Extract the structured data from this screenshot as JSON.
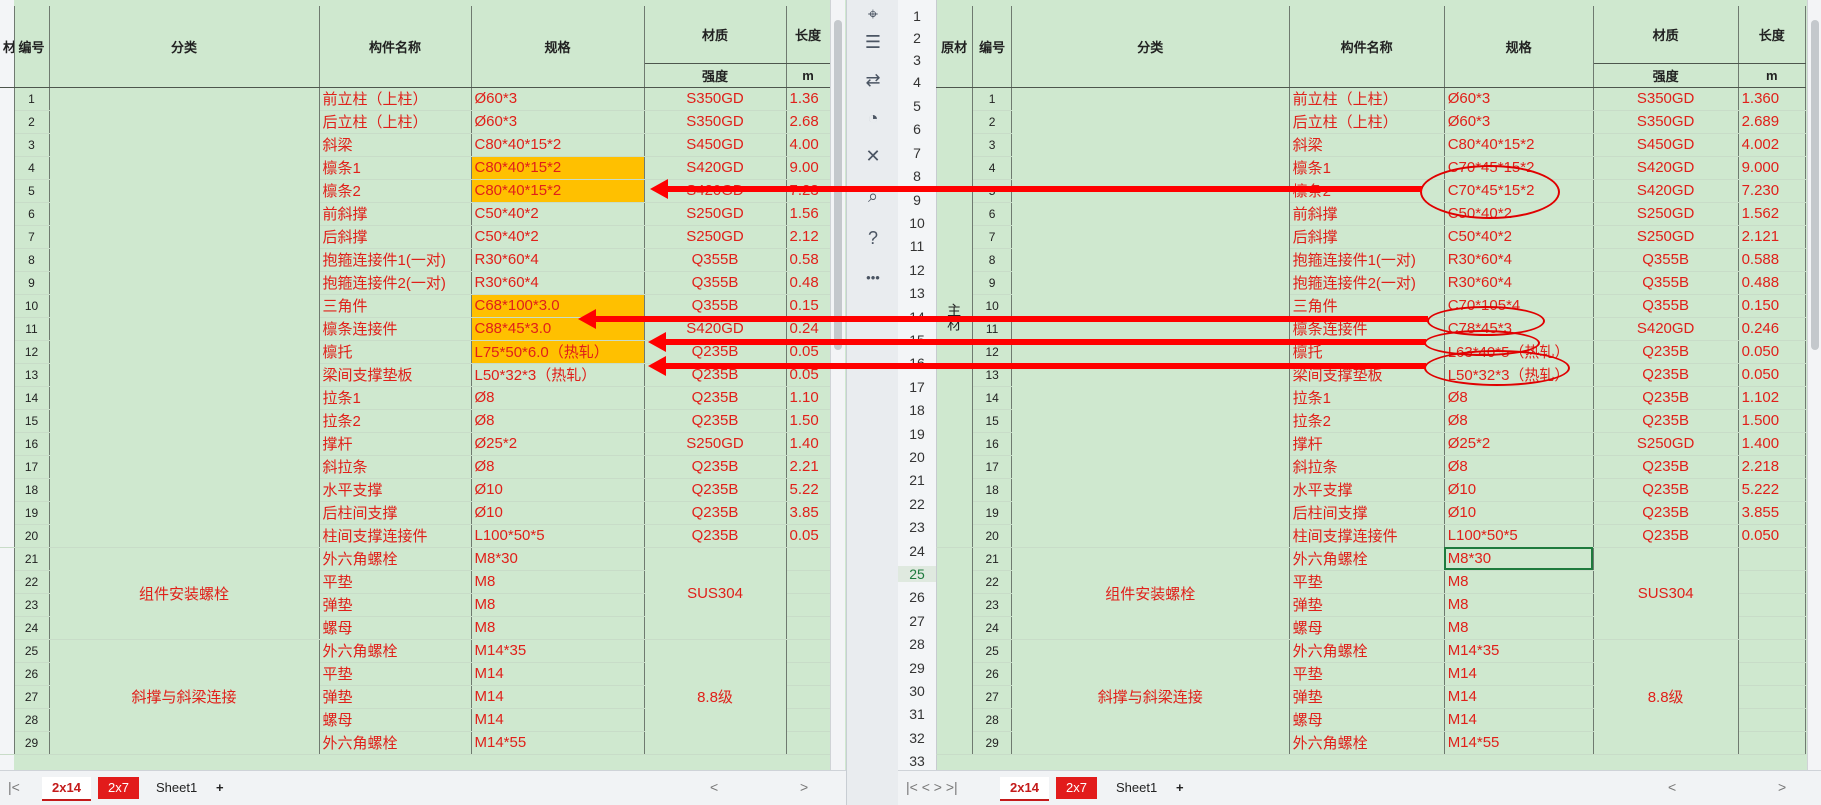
{
  "headers": {
    "yuancai": "原材",
    "biaohao": "编号",
    "fenlei": "分类",
    "goujian": "构件名称",
    "guige": "规格",
    "caizhi": "材质",
    "qiangdu": "强度",
    "changdu": "长度",
    "unit_m": "m",
    "left_clip": "材"
  },
  "zhucai_label": "主材",
  "left_rows": [
    {
      "no": "1",
      "name": "前立柱（上柱）",
      "spec": "Ø60*3",
      "mat": "S350GD",
      "len": "1.36"
    },
    {
      "no": "2",
      "name": "后立柱（上柱）",
      "spec": "Ø60*3",
      "mat": "S350GD",
      "len": "2.68"
    },
    {
      "no": "3",
      "name": "斜梁",
      "spec": "C80*40*15*2",
      "mat": "S450GD",
      "len": "4.00"
    },
    {
      "no": "4",
      "name": "檩条1",
      "spec": "C80*40*15*2",
      "mat": "S420GD",
      "len": "9.00",
      "hl": true
    },
    {
      "no": "5",
      "name": "檩条2",
      "spec": "C80*40*15*2",
      "mat": "S420GD",
      "len": "7.23",
      "hl": true
    },
    {
      "no": "6",
      "name": "前斜撑",
      "spec": "C50*40*2",
      "mat": "S250GD",
      "len": "1.56"
    },
    {
      "no": "7",
      "name": "后斜撑",
      "spec": "C50*40*2",
      "mat": "S250GD",
      "len": "2.12"
    },
    {
      "no": "8",
      "name": "抱箍连接件1(一对)",
      "spec": "R30*60*4",
      "mat": "Q355B",
      "len": "0.58"
    },
    {
      "no": "9",
      "name": "抱箍连接件2(一对)",
      "spec": "R30*60*4",
      "mat": "Q355B",
      "len": "0.48"
    },
    {
      "no": "10",
      "name": "三角件",
      "spec": "C68*100*3.0",
      "mat": "Q355B",
      "len": "0.15",
      "hl": true
    },
    {
      "no": "11",
      "name": "檩条连接件",
      "spec": "C88*45*3.0",
      "mat": "S420GD",
      "len": "0.24",
      "hl": true
    },
    {
      "no": "12",
      "name": "檩托",
      "spec": "L75*50*6.0（热轧）",
      "mat": "Q235B",
      "len": "0.05",
      "hl": true
    },
    {
      "no": "13",
      "name": "梁间支撑垫板",
      "spec": "L50*32*3（热轧）",
      "mat": "Q235B",
      "len": "0.05"
    },
    {
      "no": "14",
      "name": "拉条1",
      "spec": "Ø8",
      "mat": "Q235B",
      "len": "1.10"
    },
    {
      "no": "15",
      "name": "拉条2",
      "spec": "Ø8",
      "mat": "Q235B",
      "len": "1.50"
    },
    {
      "no": "16",
      "name": "撑杆",
      "spec": "Ø25*2",
      "mat": "S250GD",
      "len": "1.40"
    },
    {
      "no": "17",
      "name": "斜拉条",
      "spec": "Ø8",
      "mat": "Q235B",
      "len": "2.21"
    },
    {
      "no": "18",
      "name": "水平支撑",
      "spec": "Ø10",
      "mat": "Q235B",
      "len": "5.22"
    },
    {
      "no": "19",
      "name": "后柱间支撑",
      "spec": "Ø10",
      "mat": "Q235B",
      "len": "3.85"
    },
    {
      "no": "20",
      "name": "柱间支撑连接件",
      "spec": "L100*50*5",
      "mat": "Q235B",
      "len": "0.05"
    },
    {
      "no": "21",
      "name": "外六角螺栓",
      "spec": "M8*30",
      "mat": "",
      "len": ""
    },
    {
      "no": "22",
      "name": "平垫",
      "spec": "M8",
      "mat": "SUS304",
      "len": ""
    },
    {
      "no": "23",
      "name": "弹垫",
      "spec": "M8",
      "mat": "",
      "len": ""
    },
    {
      "no": "24",
      "name": "螺母",
      "spec": "M8",
      "mat": "",
      "len": ""
    },
    {
      "no": "25",
      "name": "外六角螺栓",
      "spec": "M14*35",
      "mat": "",
      "len": ""
    },
    {
      "no": "26",
      "name": "平垫",
      "spec": "M14",
      "mat": "8.8级",
      "len": ""
    },
    {
      "no": "27",
      "name": "弹垫",
      "spec": "M14",
      "mat": "",
      "len": ""
    },
    {
      "no": "28",
      "name": "螺母",
      "spec": "M14",
      "mat": "",
      "len": ""
    },
    {
      "no": "29",
      "name": "外六角螺栓",
      "spec": "M14*55",
      "mat": "",
      "len": ""
    }
  ],
  "right_rows": [
    {
      "no": "1",
      "name": "前立柱（上柱）",
      "spec": "Ø60*3",
      "mat": "S350GD",
      "len": "1.360"
    },
    {
      "no": "2",
      "name": "后立柱（上柱）",
      "spec": "Ø60*3",
      "mat": "S350GD",
      "len": "2.689"
    },
    {
      "no": "3",
      "name": "斜梁",
      "spec": "C80*40*15*2",
      "mat": "S450GD",
      "len": "4.002"
    },
    {
      "no": "4",
      "name": "檩条1",
      "spec": "C70*45*15*2",
      "mat": "S420GD",
      "len": "9.000"
    },
    {
      "no": "5",
      "name": "檩条2",
      "spec": "C70*45*15*2",
      "mat": "S420GD",
      "len": "7.230"
    },
    {
      "no": "6",
      "name": "前斜撑",
      "spec": "C50*40*2",
      "mat": "S250GD",
      "len": "1.562"
    },
    {
      "no": "7",
      "name": "后斜撑",
      "spec": "C50*40*2",
      "mat": "S250GD",
      "len": "2.121"
    },
    {
      "no": "8",
      "name": "抱箍连接件1(一对)",
      "spec": "R30*60*4",
      "mat": "Q355B",
      "len": "0.588"
    },
    {
      "no": "9",
      "name": "抱箍连接件2(一对)",
      "spec": "R30*60*4",
      "mat": "Q355B",
      "len": "0.488"
    },
    {
      "no": "10",
      "name": "三角件",
      "spec": "C70*105*4",
      "mat": "Q355B",
      "len": "0.150"
    },
    {
      "no": "11",
      "name": "檩条连接件",
      "spec": "C78*45*3",
      "mat": "S420GD",
      "len": "0.246"
    },
    {
      "no": "12",
      "name": "檩托",
      "spec": "L63*40*5（热轧）",
      "mat": "Q235B",
      "len": "0.050"
    },
    {
      "no": "13",
      "name": "梁间支撑垫板",
      "spec": "L50*32*3（热轧）",
      "mat": "Q235B",
      "len": "0.050"
    },
    {
      "no": "14",
      "name": "拉条1",
      "spec": "Ø8",
      "mat": "Q235B",
      "len": "1.102"
    },
    {
      "no": "15",
      "name": "拉条2",
      "spec": "Ø8",
      "mat": "Q235B",
      "len": "1.500"
    },
    {
      "no": "16",
      "name": "撑杆",
      "spec": "Ø25*2",
      "mat": "S250GD",
      "len": "1.400"
    },
    {
      "no": "17",
      "name": "斜拉条",
      "spec": "Ø8",
      "mat": "Q235B",
      "len": "2.218"
    },
    {
      "no": "18",
      "name": "水平支撑",
      "spec": "Ø10",
      "mat": "Q235B",
      "len": "5.222"
    },
    {
      "no": "19",
      "name": "后柱间支撑",
      "spec": "Ø10",
      "mat": "Q235B",
      "len": "3.855"
    },
    {
      "no": "20",
      "name": "柱间支撑连接件",
      "spec": "L100*50*5",
      "mat": "Q235B",
      "len": "0.050"
    },
    {
      "no": "21",
      "name": "外六角螺栓",
      "spec": "M8*30",
      "mat": "",
      "len": "",
      "sel": true
    },
    {
      "no": "22",
      "name": "平垫",
      "spec": "M8",
      "mat": "SUS304",
      "len": ""
    },
    {
      "no": "23",
      "name": "弹垫",
      "spec": "M8",
      "mat": "",
      "len": ""
    },
    {
      "no": "24",
      "name": "螺母",
      "spec": "M8",
      "mat": "",
      "len": ""
    },
    {
      "no": "25",
      "name": "外六角螺栓",
      "spec": "M14*35",
      "mat": "",
      "len": ""
    },
    {
      "no": "26",
      "name": "平垫",
      "spec": "M14",
      "mat": "8.8级",
      "len": ""
    },
    {
      "no": "27",
      "name": "弹垫",
      "spec": "M14",
      "mat": "",
      "len": ""
    },
    {
      "no": "28",
      "name": "螺母",
      "spec": "M14",
      "mat": "",
      "len": ""
    },
    {
      "no": "29",
      "name": "外六角螺栓",
      "spec": "M14*55",
      "mat": "",
      "len": ""
    }
  ],
  "groups": {
    "bolts": "组件安装螺栓",
    "brace": "斜撑与斜梁连接"
  },
  "right_row_numbers": [
    "1",
    "2",
    "3",
    "4",
    "5",
    "6",
    "7",
    "8",
    "9",
    "10",
    "11",
    "12",
    "13",
    "14",
    "15",
    "16",
    "17",
    "18",
    "19",
    "20",
    "21",
    "22",
    "23",
    "24",
    "25",
    "26",
    "27",
    "28",
    "29",
    "30",
    "31",
    "32",
    "33"
  ],
  "tabs": [
    {
      "label": "2x14",
      "active": true
    },
    {
      "label": "2x7",
      "red": true
    },
    {
      "label": "Sheet1"
    }
  ],
  "add_tab": "+",
  "mid_icons": [
    "cursor-icon",
    "sliders-icon",
    "share-icon",
    "chart-icon",
    "tools-icon",
    "find-icon",
    "help-icon",
    "more-icon"
  ],
  "more_glyph": "•••",
  "help_glyph": "?",
  "colors": {
    "sheet_bg": "#cfe8cf",
    "text_red": "#e0201a",
    "highlight": "#ffc000",
    "arrow": "#ff0000"
  }
}
